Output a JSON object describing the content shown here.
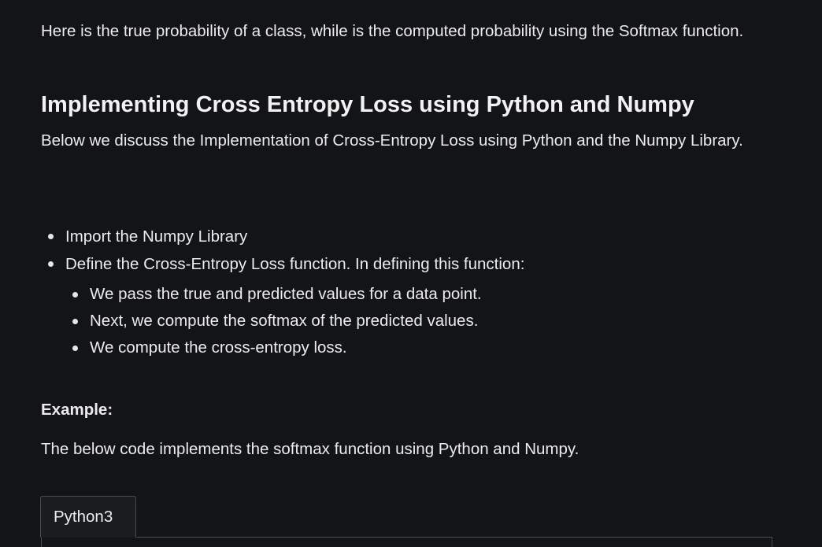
{
  "intro_text": "Here is the true probability of a class, while is the computed probability using the Softmax function.",
  "section_heading": "Implementing Cross Entropy Loss using Python and Numpy",
  "section_description": "Below we discuss the Implementation of Cross-Entropy Loss using Python and the Numpy Library.",
  "steps": [
    "Import the Numpy Library",
    "Define the Cross-Entropy Loss function. In defining this function:"
  ],
  "substeps": [
    "We pass the true and predicted values for a data point.",
    "Next, we compute the softmax of the predicted values.",
    "We compute the cross-entropy loss."
  ],
  "example_label": "Example:",
  "code_intro": "The below code implements the softmax function using Python and Numpy.",
  "code_tab_label": "Python3"
}
